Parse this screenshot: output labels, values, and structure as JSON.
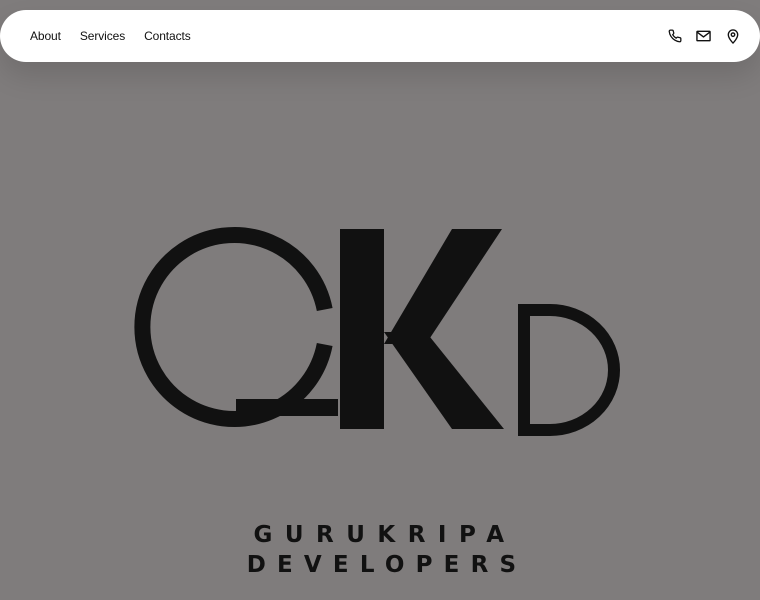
{
  "nav": {
    "links": [
      {
        "label": "About"
      },
      {
        "label": "Services"
      },
      {
        "label": "Contacts"
      }
    ],
    "icons": [
      "phone-icon",
      "mail-icon",
      "location-pin-icon"
    ]
  },
  "logo": {
    "monogram": "GKD",
    "line1": "GURUKRIPA",
    "line2": "DEVELOPERS"
  },
  "colors": {
    "background": "#7f7c7c",
    "navbar": "#ffffff",
    "logo_ink": "#111111"
  }
}
